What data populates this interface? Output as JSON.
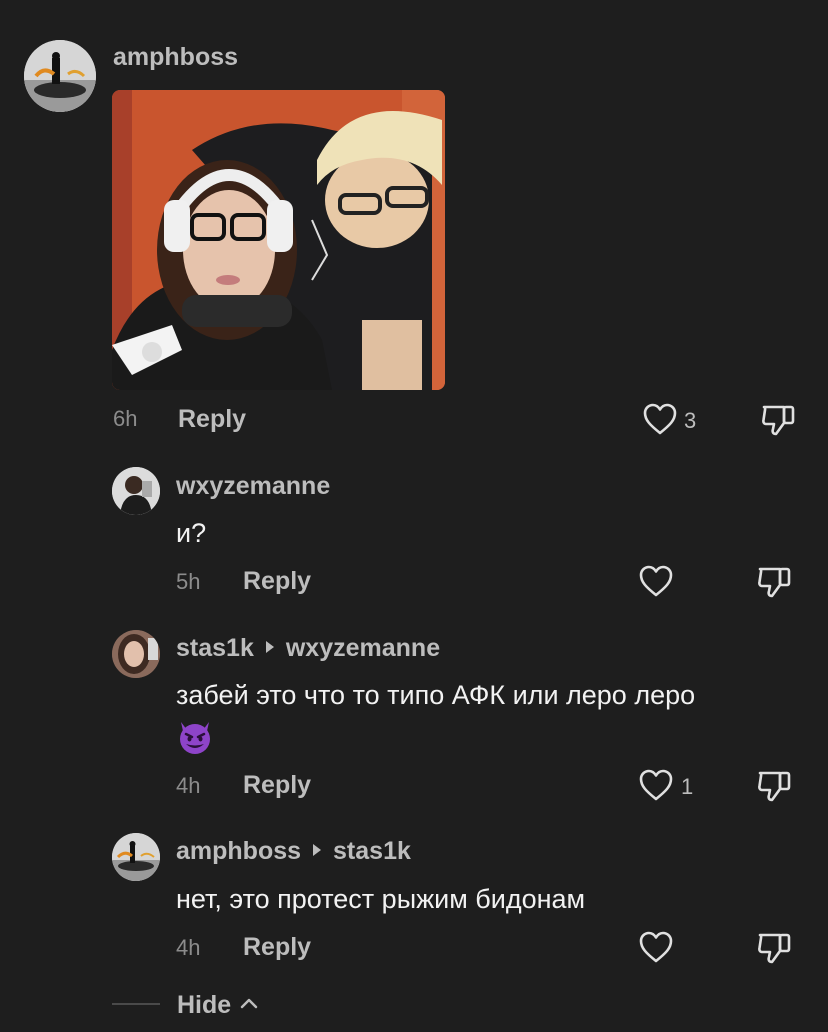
{
  "comments": [
    {
      "username": "amphboss",
      "time": "6h",
      "reply_label": "Reply",
      "likes": "3",
      "avatar_icon": "car-avatar",
      "attachment_icon": "photo-attachment"
    },
    {
      "username": "wxyzemanne",
      "text": "и?",
      "time": "5h",
      "reply_label": "Reply",
      "avatar_icon": "person-avatar"
    },
    {
      "username": "stas1k",
      "reply_to": "wxyzemanne",
      "text_line1": "забей это что то типо АФК или леро леро",
      "emoji": "😈",
      "time": "4h",
      "reply_label": "Reply",
      "likes": "1",
      "avatar_icon": "person-avatar"
    },
    {
      "username": "amphboss",
      "reply_to": "stas1k",
      "text": "нет, это протест рыжим бидонам",
      "time": "4h",
      "reply_label": "Reply",
      "avatar_icon": "car-avatar"
    }
  ],
  "hide_label": "Hide",
  "colors": {
    "background": "#1e1e1e",
    "text": "#f2f2f2",
    "muted": "#bdbdbd",
    "time": "#8c8c8c",
    "emoji": "#8e44c9"
  }
}
